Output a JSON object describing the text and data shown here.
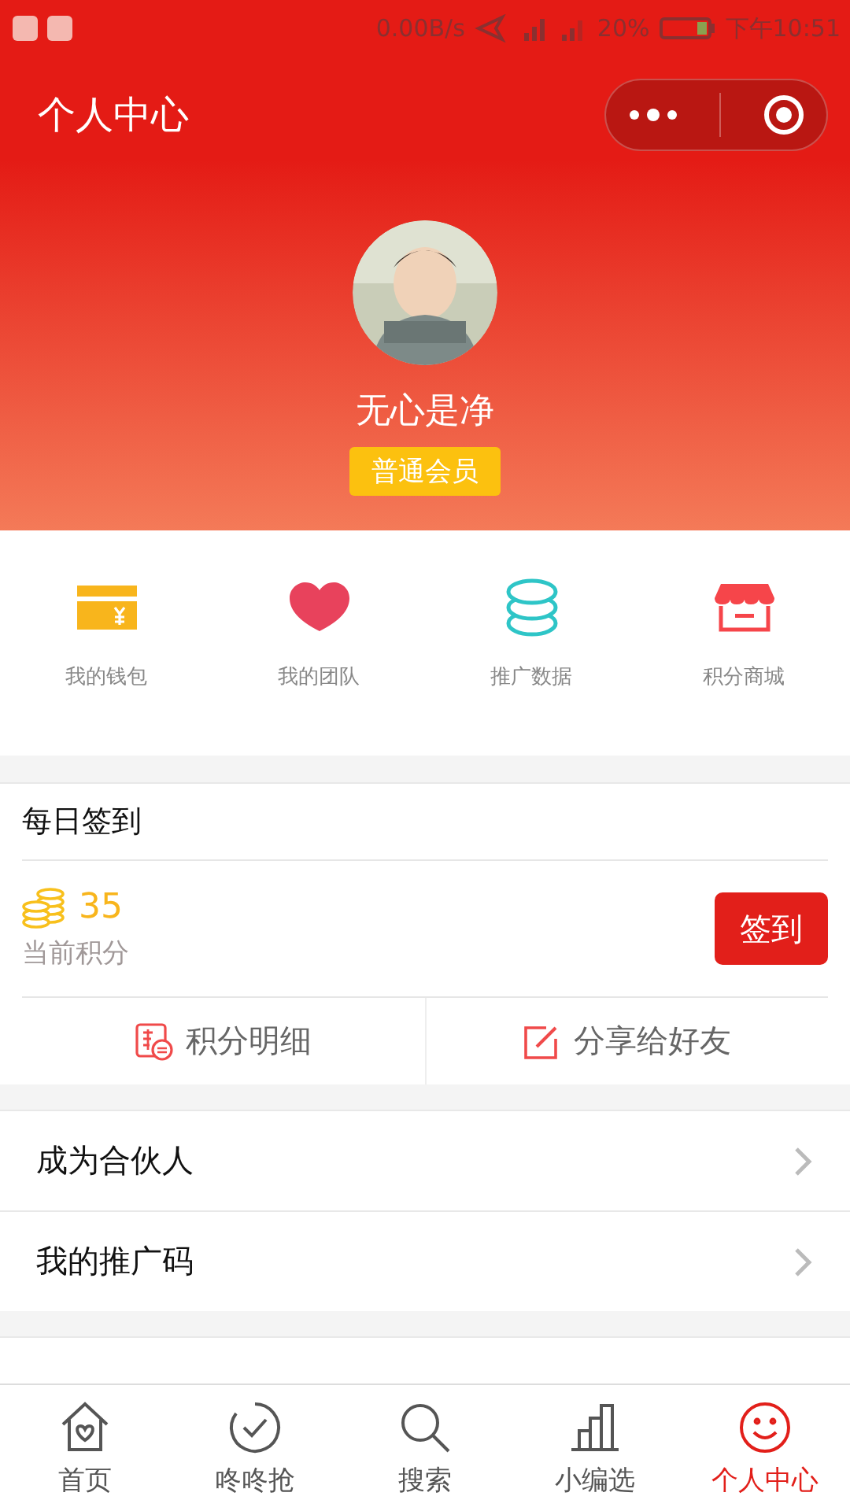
{
  "status_bar": {
    "speed": "0.00B/s",
    "battery": "20%",
    "time": "下午10:51"
  },
  "nav": {
    "title": "个人中心"
  },
  "profile": {
    "name": "无心是净",
    "badge": "普通会员"
  },
  "shortcuts": [
    {
      "label": "我的钱包",
      "kind": "wallet"
    },
    {
      "label": "我的团队",
      "kind": "heart"
    },
    {
      "label": "推广数据",
      "kind": "coins"
    },
    {
      "label": "积分商城",
      "kind": "store"
    }
  ],
  "checkin": {
    "title": "每日签到",
    "points": "35",
    "points_label": "当前积分",
    "button": "签到",
    "actions": [
      {
        "label": "积分明细",
        "kind": "detail"
      },
      {
        "label": "分享给好友",
        "kind": "share"
      }
    ]
  },
  "menu_groups": [
    [
      {
        "label": "成为合伙人"
      },
      {
        "label": "我的推广码"
      }
    ]
  ],
  "tabs": [
    {
      "label": "首页",
      "kind": "home",
      "selected": false
    },
    {
      "label": "咚咚抢",
      "kind": "clock",
      "selected": false
    },
    {
      "label": "搜索",
      "kind": "search",
      "selected": false
    },
    {
      "label": "小编选",
      "kind": "chart",
      "selected": false
    },
    {
      "label": "个人中心",
      "kind": "smile",
      "selected": true
    }
  ]
}
